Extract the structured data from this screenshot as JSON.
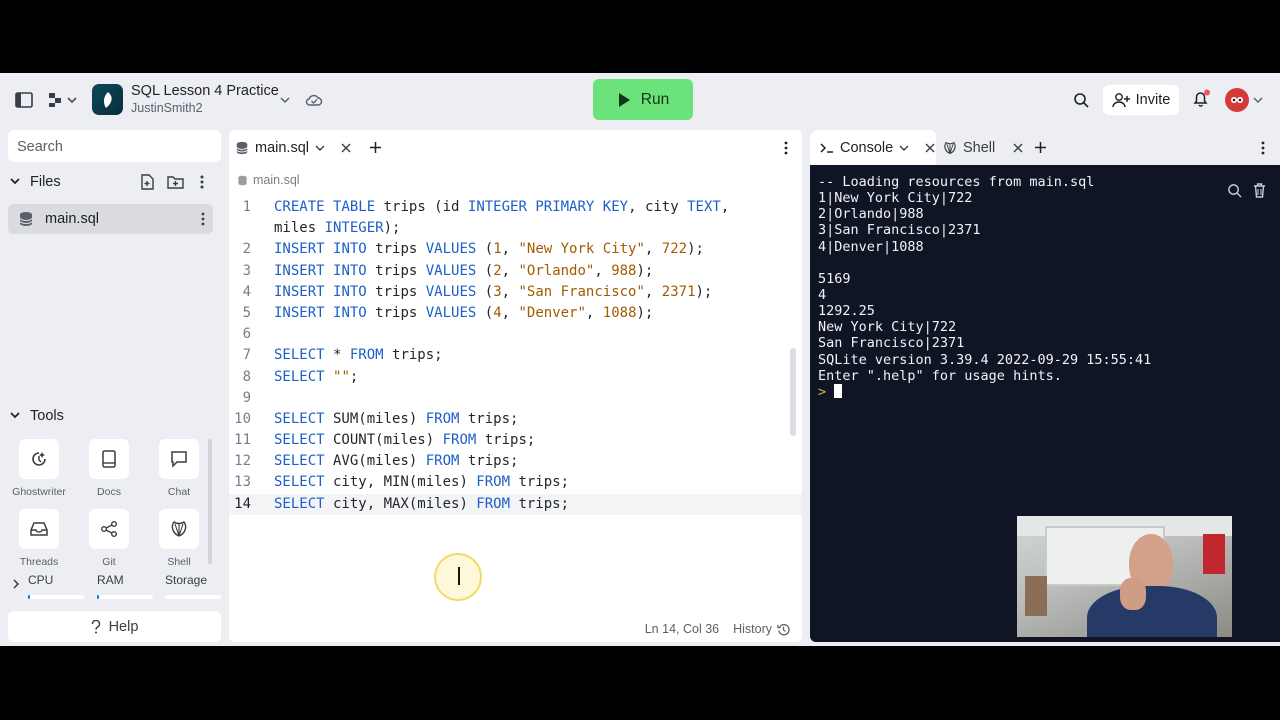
{
  "header": {
    "project_title": "SQL Lesson 4 Practice",
    "project_user": "JustinSmith2",
    "run_label": "Run",
    "invite_label": "Invite"
  },
  "sidebar": {
    "search_placeholder": "Search",
    "files_label": "Files",
    "files": [
      {
        "name": "main.sql"
      }
    ],
    "tools_label": "Tools",
    "tools": [
      {
        "label": "Ghostwriter",
        "icon": "ghostwriter-icon"
      },
      {
        "label": "Docs",
        "icon": "docs-icon"
      },
      {
        "label": "Chat",
        "icon": "chat-icon"
      },
      {
        "label": "Threads",
        "icon": "threads-icon"
      },
      {
        "label": "Git",
        "icon": "git-icon"
      },
      {
        "label": "Shell",
        "icon": "shell-icon"
      }
    ],
    "resources": [
      {
        "label": "CPU",
        "usage": 0.02
      },
      {
        "label": "RAM",
        "usage": 0.02
      },
      {
        "label": "Storage",
        "usage": 0
      }
    ],
    "help_label": "Help"
  },
  "editor": {
    "tab_label": "main.sql",
    "breadcrumb": "main.sql",
    "lines": [
      {
        "n": "1",
        "text": "CREATE TABLE trips (id INTEGER PRIMARY KEY, city TEXT,"
      },
      {
        "n": "",
        "text": "miles INTEGER);"
      },
      {
        "n": "2",
        "text": "INSERT INTO trips VALUES (1, \"New York City\", 722);"
      },
      {
        "n": "3",
        "text": "INSERT INTO trips VALUES (2, \"Orlando\", 988);"
      },
      {
        "n": "4",
        "text": "INSERT INTO trips VALUES (3, \"San Francisco\", 2371);"
      },
      {
        "n": "5",
        "text": "INSERT INTO trips VALUES (4, \"Denver\", 1088);"
      },
      {
        "n": "6",
        "text": ""
      },
      {
        "n": "7",
        "text": "SELECT * FROM trips;"
      },
      {
        "n": "8",
        "text": "SELECT \"\";"
      },
      {
        "n": "9",
        "text": ""
      },
      {
        "n": "10",
        "text": "SELECT SUM(miles) FROM trips;"
      },
      {
        "n": "11",
        "text": "SELECT COUNT(miles) FROM trips;"
      },
      {
        "n": "12",
        "text": "SELECT AVG(miles) FROM trips;"
      },
      {
        "n": "13",
        "text": "SELECT city, MIN(miles) FROM trips;"
      },
      {
        "n": "14",
        "text": "SELECT city, MAX(miles) FROM trips;"
      }
    ],
    "active_line": "14",
    "cursor_position": "Ln 14, Col 36",
    "history_label": "History"
  },
  "console": {
    "tab_console": "Console",
    "tab_shell": "Shell",
    "output": [
      "-- Loading resources from main.sql",
      "1|New York City|722",
      "2|Orlando|988",
      "3|San Francisco|2371",
      "4|Denver|1088",
      "",
      "5169",
      "4",
      "1292.25",
      "New York City|722",
      "San Francisco|2371",
      "SQLite version 3.39.4 2022-09-29 15:55:41",
      "Enter \".help\" for usage hints."
    ],
    "prompt": ">"
  },
  "colors": {
    "run_button": "#6ce37a",
    "console_bg": "#0f1524",
    "keyword": "#1c5fc8",
    "string": "#a15c00",
    "app_bg": "#eceef3"
  }
}
